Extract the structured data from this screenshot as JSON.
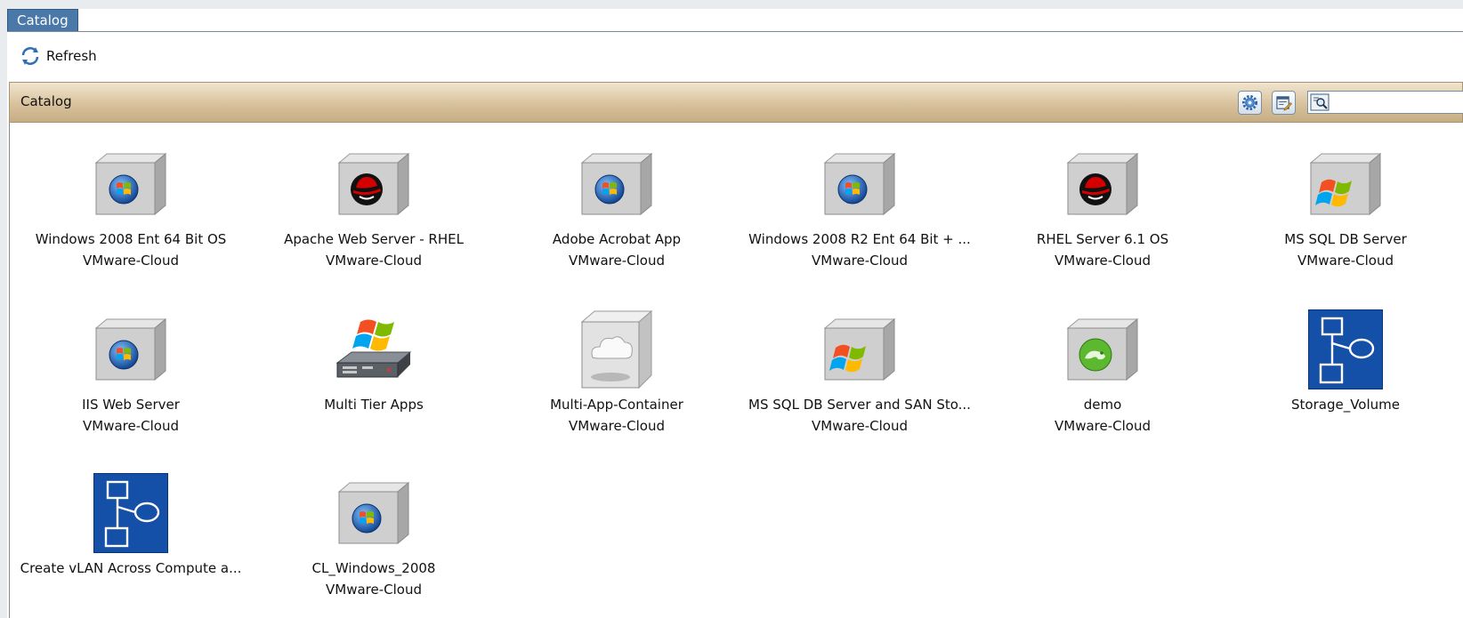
{
  "tab": {
    "label": "Catalog"
  },
  "toolbar": {
    "refresh_label": "Refresh"
  },
  "panel": {
    "title": "Catalog",
    "search_value": ""
  },
  "items": [
    {
      "name": "Windows 2008 Ent 64 Bit OS",
      "provider": "VMware-Cloud",
      "icon": "windows-vm-icon"
    },
    {
      "name": "Apache Web Server - RHEL",
      "provider": "VMware-Cloud",
      "icon": "redhat-vm-icon"
    },
    {
      "name": "Adobe Acrobat App",
      "provider": "VMware-Cloud",
      "icon": "windows-vm-icon"
    },
    {
      "name": "Windows 2008 R2 Ent 64 Bit + ...",
      "provider": "VMware-Cloud",
      "icon": "windows-vm-icon"
    },
    {
      "name": "RHEL Server 6.1 OS",
      "provider": "VMware-Cloud",
      "icon": "redhat-vm-icon"
    },
    {
      "name": "MS SQL DB Server",
      "provider": "VMware-Cloud",
      "icon": "windows-flag-vm-icon"
    },
    {
      "name": "IIS Web Server",
      "provider": "VMware-Cloud",
      "icon": "windows-vm-icon"
    },
    {
      "name": "Multi Tier Apps",
      "provider": "",
      "icon": "multi-tier-server-icon"
    },
    {
      "name": "Multi-App-Container",
      "provider": "VMware-Cloud",
      "icon": "cloud-container-icon"
    },
    {
      "name": "MS SQL DB Server and SAN Sto...",
      "provider": "VMware-Cloud",
      "icon": "windows-flag-vm-icon"
    },
    {
      "name": "demo",
      "provider": "VMware-Cloud",
      "icon": "suse-vm-icon"
    },
    {
      "name": "Storage_Volume",
      "provider": "",
      "icon": "workflow-icon"
    },
    {
      "name": "Create vLAN Across Compute a...",
      "provider": "",
      "icon": "workflow-icon"
    },
    {
      "name": "CL_Windows_2008",
      "provider": "VMware-Cloud",
      "icon": "windows-vm-icon"
    }
  ],
  "colors": {
    "tab_active": "#4a78a8",
    "header_tan": "#d8c29c",
    "workflow_blue": "#1450a8"
  }
}
